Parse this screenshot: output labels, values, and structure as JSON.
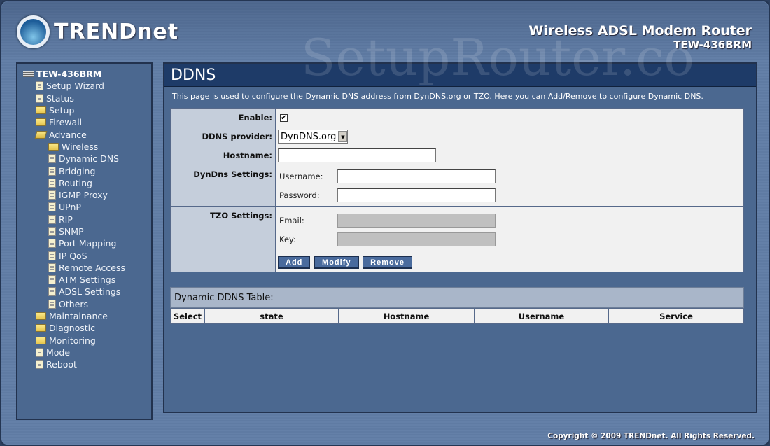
{
  "brand": {
    "logo": "TRENDnet",
    "product": "Wireless ADSL Modem Router",
    "model": "TEW-436BRM"
  },
  "watermark": "SetupRouter.co",
  "sidebar": {
    "items": [
      {
        "label": "TEW-436BRM",
        "icon": "server",
        "level": 0
      },
      {
        "label": "Setup Wizard",
        "icon": "page",
        "level": 1
      },
      {
        "label": "Status",
        "icon": "page",
        "level": 1
      },
      {
        "label": "Setup",
        "icon": "folder",
        "level": 1
      },
      {
        "label": "Firewall",
        "icon": "folder",
        "level": 1
      },
      {
        "label": "Advance",
        "icon": "folder-open",
        "level": 1
      },
      {
        "label": "Wireless",
        "icon": "folder",
        "level": 2
      },
      {
        "label": "Dynamic DNS",
        "icon": "page",
        "level": 2
      },
      {
        "label": "Bridging",
        "icon": "page",
        "level": 2
      },
      {
        "label": "Routing",
        "icon": "page",
        "level": 2
      },
      {
        "label": "IGMP Proxy",
        "icon": "page",
        "level": 2
      },
      {
        "label": "UPnP",
        "icon": "page",
        "level": 2
      },
      {
        "label": "RIP",
        "icon": "page",
        "level": 2
      },
      {
        "label": "SNMP",
        "icon": "page",
        "level": 2
      },
      {
        "label": "Port Mapping",
        "icon": "page",
        "level": 2
      },
      {
        "label": "IP QoS",
        "icon": "page",
        "level": 2
      },
      {
        "label": "Remote Access",
        "icon": "page",
        "level": 2
      },
      {
        "label": "ATM Settings",
        "icon": "page",
        "level": 2
      },
      {
        "label": "ADSL Settings",
        "icon": "page",
        "level": 2
      },
      {
        "label": "Others",
        "icon": "page",
        "level": 2
      },
      {
        "label": "Maintainance",
        "icon": "folder",
        "level": 1
      },
      {
        "label": "Diagnostic",
        "icon": "folder",
        "level": 1
      },
      {
        "label": "Monitoring",
        "icon": "folder",
        "level": 1
      },
      {
        "label": "Mode",
        "icon": "page",
        "level": 1
      },
      {
        "label": "Reboot",
        "icon": "page",
        "level": 1
      }
    ]
  },
  "main": {
    "title": "DDNS",
    "description": "This page is used to configure the Dynamic DNS address from DynDNS.org or TZO. Here you can Add/Remove to configure Dynamic DNS.",
    "form": {
      "enable_label": "Enable:",
      "enable_checked": true,
      "check_mark": "✔",
      "provider_label": "DDNS provider:",
      "provider_value": "DynDNS.org",
      "dropdown_arrow": "▼",
      "hostname_label": "Hostname:",
      "hostname_value": "",
      "dyndns_label": "DynDns Settings:",
      "username_label": "Username:",
      "username_value": "",
      "password_label": "Password:",
      "password_value": "",
      "tzo_label": "TZO Settings:",
      "email_label": "Email:",
      "email_value": "",
      "key_label": "Key:",
      "key_value": "",
      "add": "Add",
      "modify": "Modify",
      "remove": "Remove"
    },
    "table": {
      "title": "Dynamic DDNS Table:",
      "columns": [
        "Select",
        "state",
        "Hostname",
        "Username",
        "Service"
      ]
    }
  },
  "footer": {
    "copyright": "Copyright © 2009 TRENDnet. All Rights Reserved."
  }
}
